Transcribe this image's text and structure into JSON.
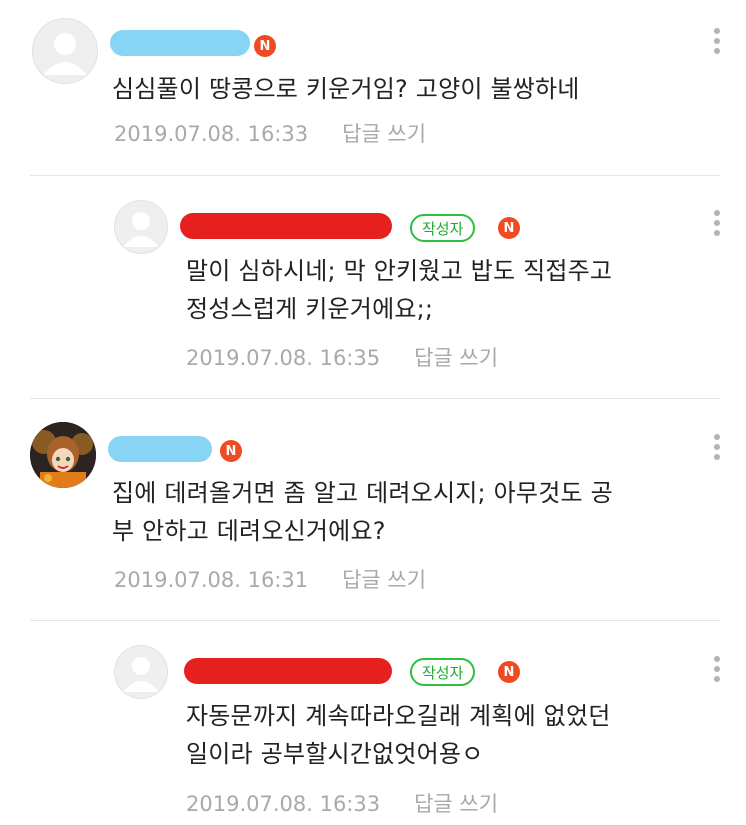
{
  "comments": [
    {
      "text": "심심풀이 땅콩으로 키운거임?  고양이 불쌍하네",
      "date": "2019.07.08. 16:33",
      "reply_label": "답글 쓰기",
      "new_badge": "N",
      "redaction_color": "#88d4f5"
    },
    {
      "text": "말이 심하시네; 막 안키웠고 밥도 직접주고\n정성스럽게 키운거에요;;",
      "date": "2019.07.08. 16:35",
      "reply_label": "답글 쓰기",
      "new_badge": "N",
      "author_badge": "작성자",
      "redaction_color": "#e5201f"
    },
    {
      "text": "집에 데려올거면 좀 알고 데려오시지; 아무것도 공\n부 안하고 데려오신거에요?",
      "date": "2019.07.08. 16:31",
      "reply_label": "답글 쓰기",
      "new_badge": "N",
      "redaction_color": "#88d4f5"
    },
    {
      "text": "자동문까지 계속따라오길래 계획에 없었던\n일이라 공부할시간없엇어용ㅇ",
      "date": "2019.07.08. 16:33",
      "reply_label": "답글 쓰기",
      "new_badge": "N",
      "author_badge": "작성자",
      "redaction_color": "#e5201f"
    }
  ],
  "colors": {
    "new_badge": "#f04a22",
    "author_badge": "#22a833",
    "meta_text": "#a9a9a9"
  }
}
